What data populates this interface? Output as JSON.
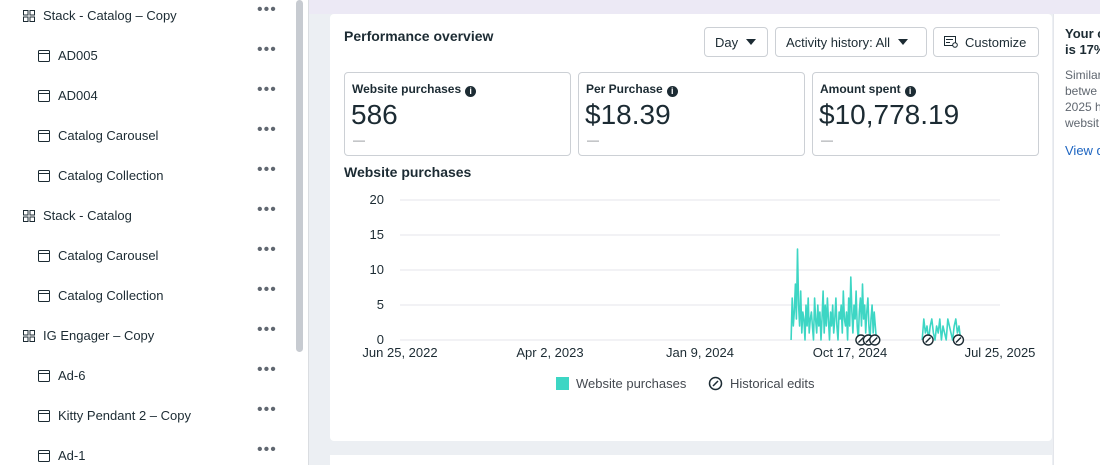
{
  "sidebar": {
    "items": [
      {
        "label": "Stack - Catalog – Copy",
        "kind": "group",
        "more": "•••"
      },
      {
        "label": "AD005",
        "kind": "ad",
        "more": "•••"
      },
      {
        "label": "AD004",
        "kind": "ad",
        "more": "•••"
      },
      {
        "label": "Catalog Carousel",
        "kind": "ad",
        "more": "•••"
      },
      {
        "label": "Catalog Collection",
        "kind": "ad",
        "more": "•••"
      },
      {
        "label": "Stack - Catalog",
        "kind": "group",
        "more": "•••"
      },
      {
        "label": "Catalog Carousel",
        "kind": "ad",
        "more": "•••"
      },
      {
        "label": "Catalog Collection",
        "kind": "ad",
        "more": "•••"
      },
      {
        "label": "IG Engager – Copy",
        "kind": "group",
        "more": "•••"
      },
      {
        "label": "Ad-6",
        "kind": "ad",
        "more": "•••"
      },
      {
        "label": "Kitty Pendant 2 – Copy",
        "kind": "ad",
        "more": "•••"
      },
      {
        "label": "Ad-1",
        "kind": "ad",
        "more": "•••"
      }
    ]
  },
  "performance": {
    "title": "Performance overview",
    "day_button": "Day",
    "activity_button": "Activity history: All",
    "customize_button": "Customize",
    "metrics": [
      {
        "label": "Website purchases",
        "value": "586",
        "sub": "—"
      },
      {
        "label": "Per Purchase",
        "value": "$18.39",
        "sub": "—"
      },
      {
        "label": "Amount spent",
        "value": "$10,778.19",
        "sub": "—"
      }
    ],
    "chart_title": "Website purchases",
    "legend_purchases": "Website purchases",
    "legend_edits": "Historical edits"
  },
  "right_panel": {
    "line1": "Your c",
    "line2": "is 17%",
    "line3": "Similar",
    "line4": "betwe",
    "line5": "2025 h",
    "line6": "websit",
    "link": "View d"
  },
  "colors": {
    "series": "#3dd6c4",
    "grid": "#e4e6eb",
    "text": "#1c2b33",
    "link": "#1d65c1"
  },
  "chart_data": {
    "type": "line",
    "title": "Website purchases",
    "xlabel": "",
    "ylabel": "",
    "ylim": [
      0,
      20
    ],
    "yticks": [
      "0",
      "5",
      "10",
      "15",
      "20"
    ],
    "xticks": [
      "Jun 25, 2022",
      "Apr 2, 2023",
      "Jan 9, 2024",
      "Oct 17, 2024",
      "Jul 25, 2025"
    ],
    "xlim": [
      "2022-06-25",
      "2025-07-25"
    ],
    "series": [
      {
        "name": "Website purchases",
        "x": [
          "2024-06-28",
          "2024-06-30",
          "2024-07-02",
          "2024-07-04",
          "2024-07-06",
          "2024-07-08",
          "2024-07-10",
          "2024-07-12",
          "2024-07-14",
          "2024-07-16",
          "2024-07-18",
          "2024-07-20",
          "2024-07-22",
          "2024-07-24",
          "2024-07-26",
          "2024-07-28",
          "2024-07-30",
          "2024-08-01",
          "2024-08-03",
          "2024-08-05",
          "2024-08-07",
          "2024-08-09",
          "2024-08-11",
          "2024-08-13",
          "2024-08-15",
          "2024-08-17",
          "2024-08-19",
          "2024-08-21",
          "2024-08-23",
          "2024-08-25",
          "2024-08-27",
          "2024-08-29",
          "2024-08-31",
          "2024-09-02",
          "2024-09-04",
          "2024-09-06",
          "2024-09-08",
          "2024-09-10",
          "2024-09-12",
          "2024-09-14",
          "2024-09-16",
          "2024-09-18",
          "2024-09-20",
          "2024-09-22",
          "2024-09-24",
          "2024-09-26",
          "2024-09-28",
          "2024-09-30",
          "2024-10-02",
          "2024-10-04",
          "2024-10-06",
          "2024-10-08",
          "2024-10-10",
          "2024-10-12",
          "2024-10-14",
          "2024-10-16",
          "2024-10-18",
          "2024-10-20",
          "2024-10-22",
          "2024-10-24",
          "2024-10-26",
          "2024-10-28",
          "2024-10-30",
          "2024-11-01",
          "2024-11-03",
          "2024-11-05",
          "2024-11-07",
          "2024-11-09",
          "2024-11-11",
          "2024-11-13",
          "2024-11-15",
          "2024-11-17",
          "2024-11-19",
          "2024-11-21",
          "2024-11-23",
          "2024-11-25",
          "2024-11-27",
          "2024-11-29",
          "2024-12-01",
          "2024-12-03",
          "2024-12-05",
          "2025-03-01",
          "2025-03-04",
          "2025-03-07",
          "2025-03-10",
          "2025-03-13",
          "2025-03-16",
          "2025-03-19",
          "2025-03-22",
          "2025-03-25",
          "2025-03-28",
          "2025-03-31",
          "2025-04-03",
          "2025-04-06",
          "2025-04-09",
          "2025-04-12",
          "2025-04-15",
          "2025-04-18",
          "2025-04-21",
          "2025-04-24",
          "2025-04-27",
          "2025-04-30",
          "2025-05-03",
          "2025-05-06",
          "2025-05-09",
          "2025-05-12"
        ],
        "values": [
          0,
          6,
          2,
          4,
          8,
          3,
          13,
          5,
          2,
          7,
          1,
          4,
          3,
          0,
          5,
          2,
          6,
          1,
          3,
          4,
          2,
          0,
          6,
          3,
          1,
          5,
          2,
          4,
          0,
          3,
          7,
          1,
          5,
          2,
          6,
          3,
          0,
          4,
          2,
          5,
          1,
          3,
          6,
          2,
          0,
          4,
          3,
          5,
          1,
          7,
          3,
          2,
          4,
          0,
          6,
          2,
          9,
          4,
          1,
          5,
          3,
          7,
          2,
          0,
          4,
          6,
          2,
          8,
          3,
          5,
          1,
          4,
          6,
          2,
          0,
          3,
          5,
          1,
          4,
          2,
          0,
          0,
          3,
          1,
          2,
          0,
          2,
          3,
          1,
          0,
          2,
          1,
          3,
          0,
          2,
          1,
          0,
          3,
          2,
          1,
          0,
          2,
          3,
          1,
          2,
          0
        ]
      }
    ],
    "historical_edits": [
      "2024-11-06",
      "2024-11-20",
      "2024-12-02",
      "2025-03-12",
      "2025-05-08"
    ]
  }
}
